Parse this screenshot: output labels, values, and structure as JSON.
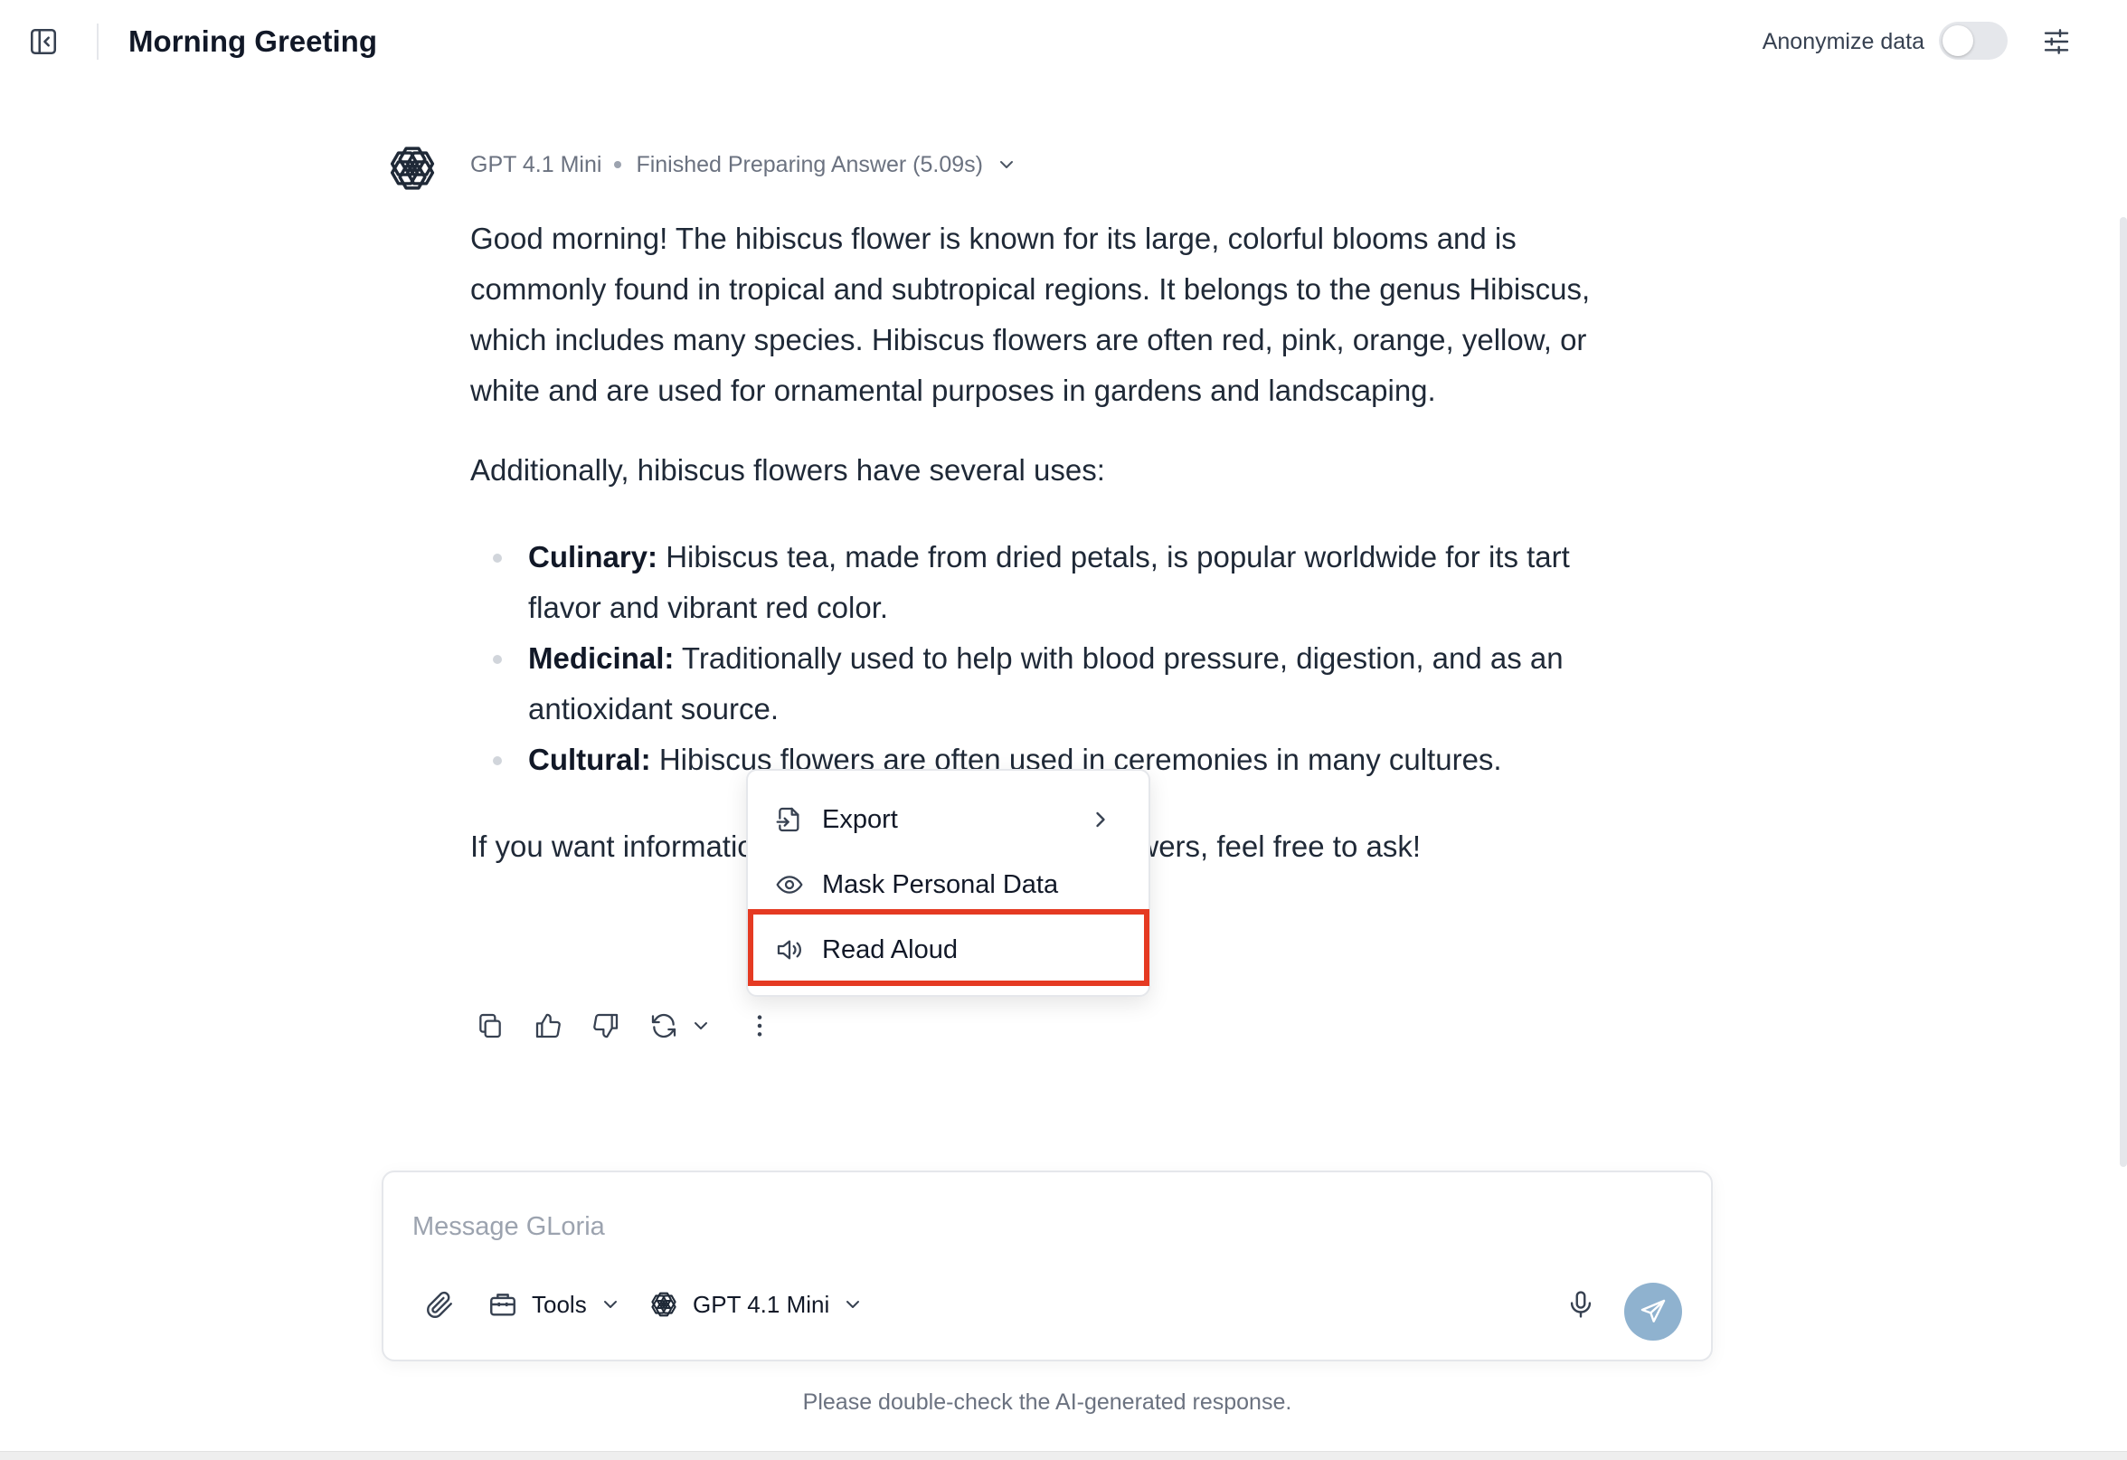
{
  "header": {
    "title": "Morning Greeting",
    "anonymize_label": "Anonymize data",
    "anonymize_on": false
  },
  "message": {
    "model": "GPT 4.1 Mini",
    "status": "Finished Preparing Answer (5.09s)",
    "paragraphs": [
      "Good morning! The hibiscus flower is known for its large, colorful blooms and is commonly found in tropical and subtropical regions. It belongs to the genus Hibiscus, which includes many species. Hibiscus flowers are often red, pink, orange, yellow, or white and are used for ornamental purposes in gardens and landscaping.",
      "Additionally, hibiscus flowers have several uses:"
    ],
    "list": [
      {
        "term": "Culinary:",
        "text": " Hibiscus tea, made from dried petals, is popular worldwide for its tart flavor and vibrant red color."
      },
      {
        "term": "Medicinal:",
        "text": " Traditionally used to help with blood pressure, digestion, and as an antioxidant source."
      },
      {
        "term": "Cultural:",
        "text": " Hibiscus flowers are often used in ceremonies in many cultures."
      }
    ],
    "closing": "If you want information on how to grow hibiscus flowers, feel free to ask!"
  },
  "context_menu": {
    "items": [
      {
        "label": "Export",
        "icon": "export-icon",
        "has_submenu": true
      },
      {
        "label": "Mask Personal Data",
        "icon": "eye-icon",
        "has_submenu": false
      },
      {
        "label": "Read Aloud",
        "icon": "speaker-icon",
        "has_submenu": false,
        "highlighted": true
      }
    ]
  },
  "composer": {
    "placeholder": "Message GLoria",
    "tools_label": "Tools",
    "model_label": "GPT 4.1 Mini"
  },
  "footer": {
    "disclaimer": "Please double-check the AI-generated response."
  },
  "colors": {
    "highlight": "#e53a22",
    "send_button": "#8fb2cf"
  }
}
